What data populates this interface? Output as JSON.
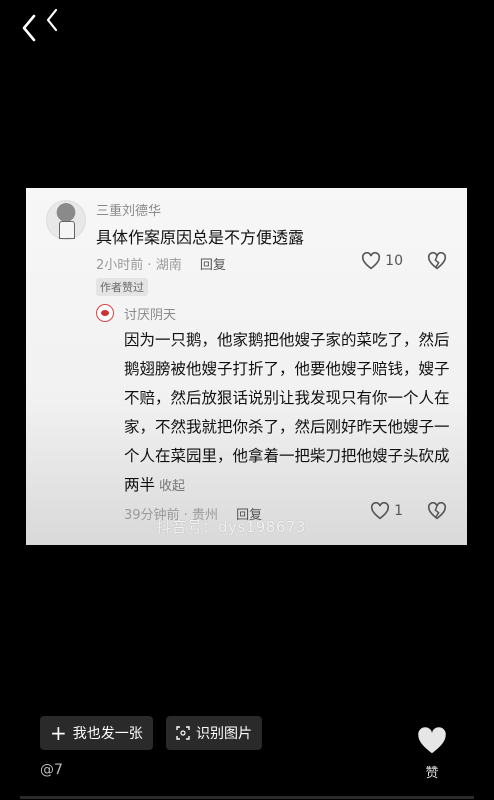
{
  "card": {
    "comment": {
      "username": "三重刘德华",
      "text": "具体作案原因总是不方便透露",
      "time": "2小时前",
      "location": "湖南",
      "reply_label": "回复",
      "likes": "10",
      "badge": "作者赞过"
    },
    "reply": {
      "username": "讨厌阴天",
      "text": "因为一只鹅，他家鹅把他嫂子家的菜吃了，然后鹅翅膀被他嫂子打折了，他要他嫂子赔钱，嫂子不赔，然后放狠话说别让我发现只有你一个人在家，不然我就把你杀了，然后刚好昨天他嫂子一个人在菜园里，他拿着一把柴刀把他嫂子头砍成两半",
      "collapse_label": "收起",
      "time": "39分钟前",
      "location": "贵州",
      "reply_label": "回复",
      "likes": "1"
    },
    "watermark": "抖音号：dys198673"
  },
  "actions": {
    "post_label": "我也发一张",
    "recognize_label": "识别图片",
    "like_label": "赞"
  },
  "handle": "@7"
}
